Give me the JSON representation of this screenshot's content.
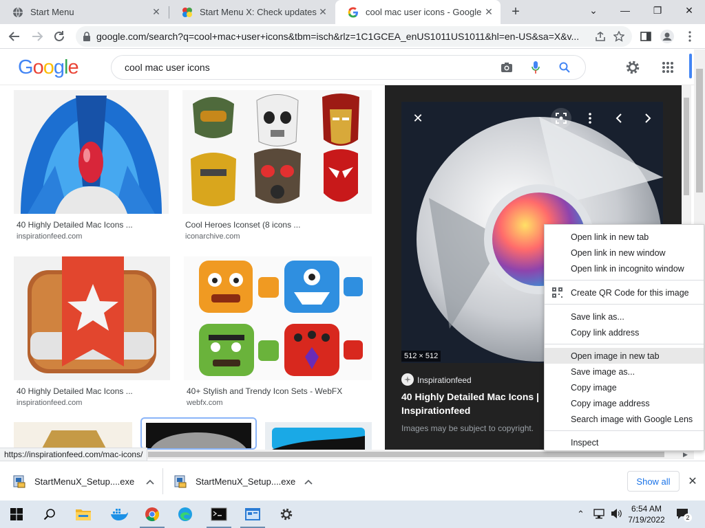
{
  "tabs": [
    {
      "title": "Start Menu"
    },
    {
      "title": "Start Menu X: Check updates"
    },
    {
      "title": "cool mac user icons - Google Sea"
    }
  ],
  "address_bar": {
    "url": "google.com/search?q=cool+mac+user+icons&tbm=isch&rlz=1C1GCEA_enUS1011US1011&hl=en-US&sa=X&v..."
  },
  "google": {
    "logo": "Google",
    "query": "cool mac user icons"
  },
  "results": [
    {
      "title": "40 Highly Detailed Mac Icons ...",
      "source": "inspirationfeed.com"
    },
    {
      "title": "Cool Heroes Iconset (8 icons ...",
      "source": "iconarchive.com"
    },
    {
      "title": "40 Highly Detailed Mac Icons ...",
      "source": "inspirationfeed.com"
    },
    {
      "title": "40+ Stylish and Trendy Icon Sets - WebFX",
      "source": "webfx.com"
    }
  ],
  "preview": {
    "dimensions": "512 × 512",
    "source": "Inspirationfeed",
    "title_line1": "40 Highly Detailed Mac Icons |",
    "title_line2": "Inspirationfeed",
    "copyright": "Images may be subject to copyright."
  },
  "status_url": "https://inspirationfeed.com/mac-icons/",
  "context_menu": {
    "items": [
      "Open link in new tab",
      "Open link in new window",
      "Open link in incognito window",
      "Create QR Code for this image",
      "Save link as...",
      "Copy link address",
      "Open image in new tab",
      "Save image as...",
      "Copy image",
      "Copy image address",
      "Search image with Google Lens",
      "Inspect"
    ]
  },
  "downloads": {
    "items": [
      {
        "name": "StartMenuX_Setup....exe"
      },
      {
        "name": "StartMenuX_Setup....exe"
      }
    ],
    "show_all": "Show all"
  },
  "taskbar": {
    "time": "6:54 AM",
    "date": "7/19/2022",
    "notification_count": "2"
  },
  "colors": {
    "google_blue": "#4285F4",
    "google_red": "#EA4335",
    "google_yellow": "#FBBC05",
    "google_green": "#34A853"
  }
}
